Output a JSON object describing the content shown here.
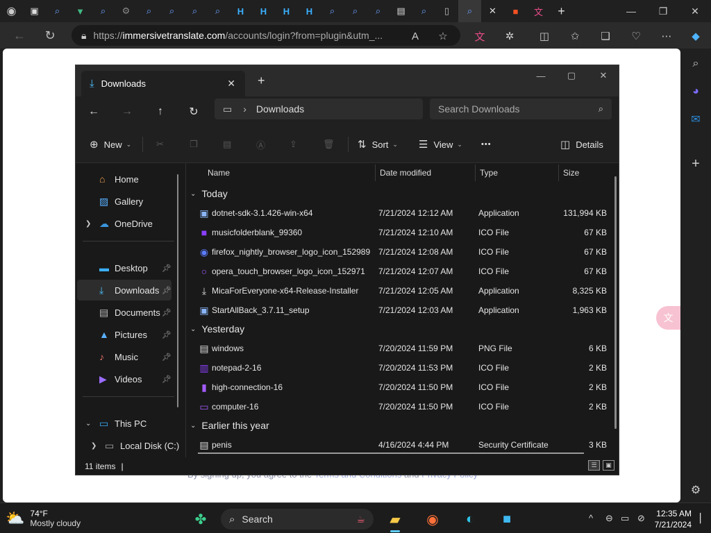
{
  "browser": {
    "url_host": "immersivetranslate.com",
    "url_rest": "/accounts/login?from=plugin&utm_...",
    "url_scheme": "https://"
  },
  "webpage": {
    "terms_prefix": "By signing up, you agree to the ",
    "terms_link1": "Terms and Conditions",
    "terms_mid": " and ",
    "terms_link2": "Privacy Policy"
  },
  "explorer": {
    "tab_title": "Downloads",
    "breadcrumb": "Downloads",
    "search_placeholder": "Search Downloads",
    "cmd": {
      "new": "New",
      "sort": "Sort",
      "view": "View",
      "more": "•••",
      "details": "Details"
    },
    "nav": {
      "home": "Home",
      "gallery": "Gallery",
      "onedrive": "OneDrive",
      "desktop": "Desktop",
      "downloads": "Downloads",
      "documents": "Documents",
      "pictures": "Pictures",
      "music": "Music",
      "videos": "Videos",
      "thispc": "This PC",
      "localdisk": "Local Disk (C:)"
    },
    "columns": {
      "name": "Name",
      "date": "Date modified",
      "type": "Type",
      "size": "Size"
    },
    "groups": {
      "today": "Today",
      "yesterday": "Yesterday",
      "earlier": "Earlier this year"
    },
    "today": [
      {
        "name": "dotnet-sdk-3.1.426-win-x64",
        "date": "7/21/2024 12:12 AM",
        "type": "Application",
        "size": "131,994 KB"
      },
      {
        "name": "musicfolderblank_99360",
        "date": "7/21/2024 12:10 AM",
        "type": "ICO File",
        "size": "67 KB"
      },
      {
        "name": "firefox_nightly_browser_logo_icon_152989",
        "date": "7/21/2024 12:08 AM",
        "type": "ICO File",
        "size": "67 KB"
      },
      {
        "name": "opera_touch_browser_logo_icon_152971",
        "date": "7/21/2024 12:07 AM",
        "type": "ICO File",
        "size": "67 KB"
      },
      {
        "name": "MicaForEveryone-x64-Release-Installer",
        "date": "7/21/2024 12:05 AM",
        "type": "Application",
        "size": "8,325 KB"
      },
      {
        "name": "StartAllBack_3.7.11_setup",
        "date": "7/21/2024 12:03 AM",
        "type": "Application",
        "size": "1,963 KB"
      }
    ],
    "yesterday": [
      {
        "name": "windows",
        "date": "7/20/2024 11:59 PM",
        "type": "PNG File",
        "size": "6 KB"
      },
      {
        "name": "notepad-2-16",
        "date": "7/20/2024 11:53 PM",
        "type": "ICO File",
        "size": "2 KB"
      },
      {
        "name": "high-connection-16",
        "date": "7/20/2024 11:50 PM",
        "type": "ICO File",
        "size": "2 KB"
      },
      {
        "name": "computer-16",
        "date": "7/20/2024 11:50 PM",
        "type": "ICO File",
        "size": "2 KB"
      }
    ],
    "earlier": [
      {
        "name": "penis",
        "date": "4/16/2024 4:44 PM",
        "type": "Security Certificate",
        "size": "3 KB"
      }
    ],
    "status": "11 items"
  },
  "taskbar": {
    "temp": "74°F",
    "condition": "Mostly cloudy",
    "search": "Search",
    "time": "12:35 AM",
    "date": "7/21/2024"
  },
  "colors": {
    "accent": "#4cc2ff",
    "explorer_bg": "#191919",
    "chrome_bg": "#202020"
  }
}
